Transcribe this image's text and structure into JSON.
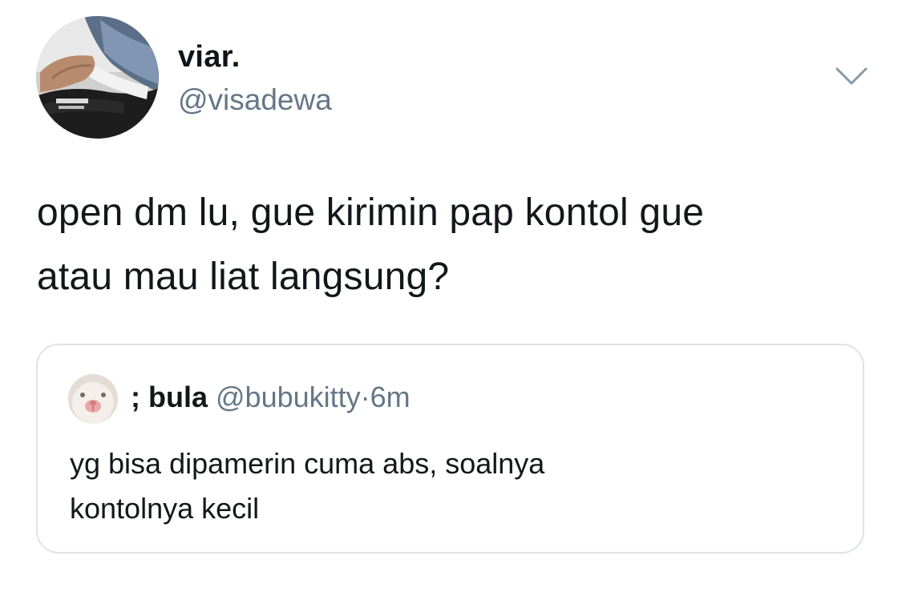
{
  "tweet": {
    "author": {
      "display_name": "viar.",
      "handle": "@visadewa",
      "avatar_icon": "profile-photo"
    },
    "menu_icon": "chevron-down-icon",
    "text_lines": [
      "open dm lu, gue kirimin pap kontol gue",
      "atau mau liat langsung?"
    ]
  },
  "quoted_tweet": {
    "author": {
      "display_name": "; bula",
      "handle": "@bubukitty",
      "avatar_icon": "cat-avatar"
    },
    "separator": "·",
    "time": "6m",
    "text_lines": [
      "yg bisa dipamerin cuma abs, soalnya",
      "kontolnya kecil"
    ]
  },
  "colors": {
    "text_primary": "#14171a",
    "text_secondary": "#657786",
    "border": "#dfe3e7",
    "background": "#ffffff"
  }
}
